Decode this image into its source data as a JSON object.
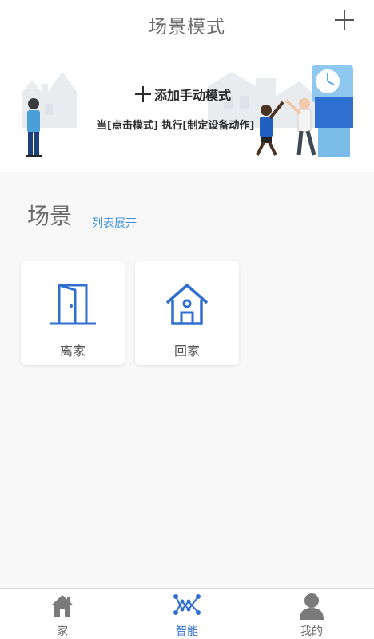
{
  "header": {
    "title": "场景模式",
    "add_icon": "plus-icon"
  },
  "banner": {
    "title": "添加手动模式",
    "subtitle": "当[点击模式] 执行[制定设备动作]"
  },
  "scenes": {
    "title": "场景",
    "expand_link": "列表展开",
    "items": [
      {
        "label": "离家",
        "icon": "door-icon"
      },
      {
        "label": "回家",
        "icon": "house-icon"
      }
    ]
  },
  "tabbar": {
    "tabs": [
      {
        "label": "家",
        "icon": "home-icon",
        "active": false
      },
      {
        "label": "智能",
        "icon": "smart-network-icon",
        "active": true
      },
      {
        "label": "我的",
        "icon": "user-icon",
        "active": false
      }
    ]
  },
  "colors": {
    "accent": "#2f6fcf",
    "link": "#3a8fdc",
    "icon_inactive": "#7a7a7a",
    "background": "#f8f8f8"
  }
}
